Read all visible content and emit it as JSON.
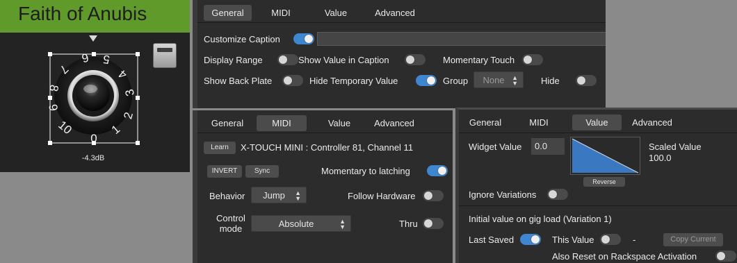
{
  "knob": {
    "title": "Faith of Anubis",
    "value": "-4.3dB",
    "scale_labels": [
      "0",
      "1",
      "2",
      "3",
      "4",
      "5",
      "6",
      "7",
      "8",
      "9",
      "10"
    ],
    "colors": {
      "title_bar": "#5f9a2b",
      "background": "#232323"
    }
  },
  "general_panel": {
    "tabs": [
      "General",
      "MIDI",
      "Value",
      "Advanced"
    ],
    "active_tab": "General",
    "customize_caption": {
      "label": "Customize Caption",
      "on": true,
      "input_value": ""
    },
    "display_range": {
      "label": "Display Range",
      "on": false
    },
    "show_value_in_caption": {
      "label": "Show Value in Caption",
      "on": false
    },
    "momentary_touch": {
      "label": "Momentary Touch",
      "on": false
    },
    "show_back_plate": {
      "label": "Show Back Plate",
      "on": false
    },
    "hide_temporary_value": {
      "label": "Hide Temporary Value",
      "on": true
    },
    "group": {
      "label": "Group",
      "value": "None"
    },
    "hide": {
      "label": "Hide",
      "on": false
    }
  },
  "midi_panel": {
    "tabs": [
      "General",
      "MIDI",
      "Value",
      "Advanced"
    ],
    "active_tab": "MIDI",
    "learn_label": "Learn",
    "assignment": "X-TOUCH MINI : Controller 81, Channel 11",
    "invert_label": "INVERT",
    "sync_label": "Sync",
    "momentary_to_latching": {
      "label": "Momentary to latching",
      "on": true
    },
    "behavior": {
      "label": "Behavior",
      "value": "Jump"
    },
    "follow_hardware": {
      "label": "Follow Hardware",
      "on": false
    },
    "control_mode": {
      "label_line1": "Control",
      "label_line2": "mode",
      "value": "Absolute"
    },
    "thru": {
      "label": "Thru",
      "on": false
    }
  },
  "value_panel": {
    "tabs": [
      "General",
      "MIDI",
      "Value",
      "Advanced"
    ],
    "active_tab": "Value",
    "widget_value_label": "Widget Value",
    "widget_value": "0.0",
    "scaled_value_label": "Scaled Value",
    "scaled_value": "100.0",
    "reverse_label": "Reverse",
    "ignore_variations": {
      "label": "Ignore Variations",
      "on": false
    },
    "initial_value_label": "Initial value on gig load (Variation 1)",
    "last_saved": {
      "label": "Last Saved",
      "on": true
    },
    "this_value": {
      "label": "This Value",
      "on": false
    },
    "this_value_display": "-",
    "copy_current_label": "Copy Current",
    "also_reset": {
      "label": "Also Reset on Rackspace Activation",
      "on": false
    },
    "accent_color": "#3e86cf"
  }
}
